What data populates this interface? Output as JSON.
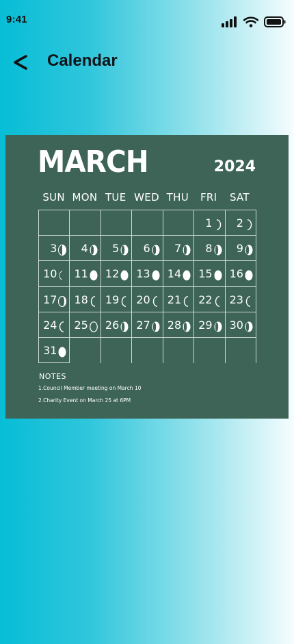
{
  "status": {
    "time": "9:41"
  },
  "header": {
    "title": "Calendar"
  },
  "calendar": {
    "month": "MARCH",
    "year": "2024",
    "weekdays": [
      "SUN",
      "MON",
      "TUE",
      "WED",
      "THU",
      "FRI",
      "SAT"
    ],
    "days": [
      {
        "n": "",
        "m": ""
      },
      {
        "n": "",
        "m": ""
      },
      {
        "n": "",
        "m": ""
      },
      {
        "n": "",
        "m": ""
      },
      {
        "n": "",
        "m": ""
      },
      {
        "n": "1",
        "m": "waning-crescent-light"
      },
      {
        "n": "2",
        "m": "waning-crescent-light"
      },
      {
        "n": "3",
        "m": "half-dark-left"
      },
      {
        "n": "4",
        "m": "gibbous"
      },
      {
        "n": "5",
        "m": "gibbous"
      },
      {
        "n": "6",
        "m": "gibbous"
      },
      {
        "n": "7",
        "m": "gibbous"
      },
      {
        "n": "8",
        "m": "gibbous"
      },
      {
        "n": "9",
        "m": "gibbous"
      },
      {
        "n": "10",
        "m": "new"
      },
      {
        "n": "11",
        "m": "waxing-gibbous"
      },
      {
        "n": "12",
        "m": "waxing-gibbous"
      },
      {
        "n": "13",
        "m": "waxing-gibbous"
      },
      {
        "n": "14",
        "m": "waxing-gibbous"
      },
      {
        "n": "15",
        "m": "waxing-gibbous"
      },
      {
        "n": "16",
        "m": "waxing-gibbous"
      },
      {
        "n": "17",
        "m": "crescent"
      },
      {
        "n": "18",
        "m": "crescent-outline"
      },
      {
        "n": "19",
        "m": "crescent-outline"
      },
      {
        "n": "20",
        "m": "crescent-outline"
      },
      {
        "n": "21",
        "m": "crescent-outline"
      },
      {
        "n": "22",
        "m": "crescent-outline"
      },
      {
        "n": "23",
        "m": "crescent-outline"
      },
      {
        "n": "24",
        "m": "crescent-outline"
      },
      {
        "n": "25",
        "m": "full-outline"
      },
      {
        "n": "26",
        "m": "gibbous"
      },
      {
        "n": "27",
        "m": "gibbous"
      },
      {
        "n": "28",
        "m": "gibbous"
      },
      {
        "n": "29",
        "m": "gibbous"
      },
      {
        "n": "30",
        "m": "gibbous"
      },
      {
        "n": "31",
        "m": "waxing-gibbous"
      },
      {
        "n": "",
        "m": ""
      },
      {
        "n": "",
        "m": ""
      },
      {
        "n": "",
        "m": ""
      },
      {
        "n": "",
        "m": ""
      },
      {
        "n": "",
        "m": ""
      },
      {
        "n": "",
        "m": ""
      }
    ]
  },
  "notes": {
    "title": "NOTES",
    "items": [
      "1.Council Member meeting on March 10",
      "2.Charity Event on March 25 at 6PM"
    ]
  }
}
